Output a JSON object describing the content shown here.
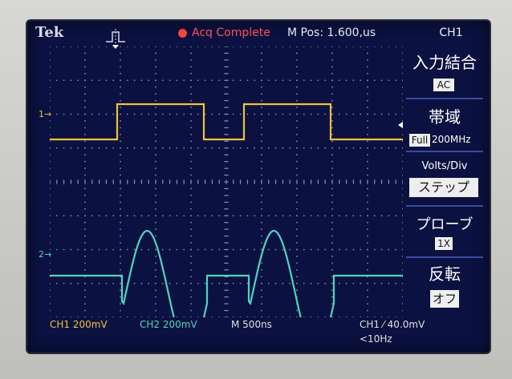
{
  "header": {
    "brand": "Tek",
    "status": "Acq Complete",
    "mpos": "M Pos: 1.600,us",
    "channel": "CH1"
  },
  "menu": {
    "coupling_label": "入力結合",
    "coupling_value": "AC",
    "bandwidth_label": "帯域",
    "bandwidth_badge": "Full",
    "bandwidth_value": "200MHz",
    "voltsdiv_label": "Volts/Div",
    "voltsdiv_value": "ステップ",
    "probe_label": "プローブ",
    "probe_value": "1X",
    "invert_label": "反転",
    "invert_value": "オフ"
  },
  "markers": {
    "ch1": "1",
    "ch2": "2"
  },
  "footer": {
    "ch1_scale": "CH1  200mV",
    "ch2_scale": "CH2  200mV",
    "timebase": "M 500ns",
    "trigger": "CH1 ⁄ 40.0mV",
    "freq": "<10Hz"
  },
  "colors": {
    "ch1": "#f0c23a",
    "ch2": "#4fd4c0",
    "screen": "#0b1140",
    "grid": "#8a8ea8"
  }
}
